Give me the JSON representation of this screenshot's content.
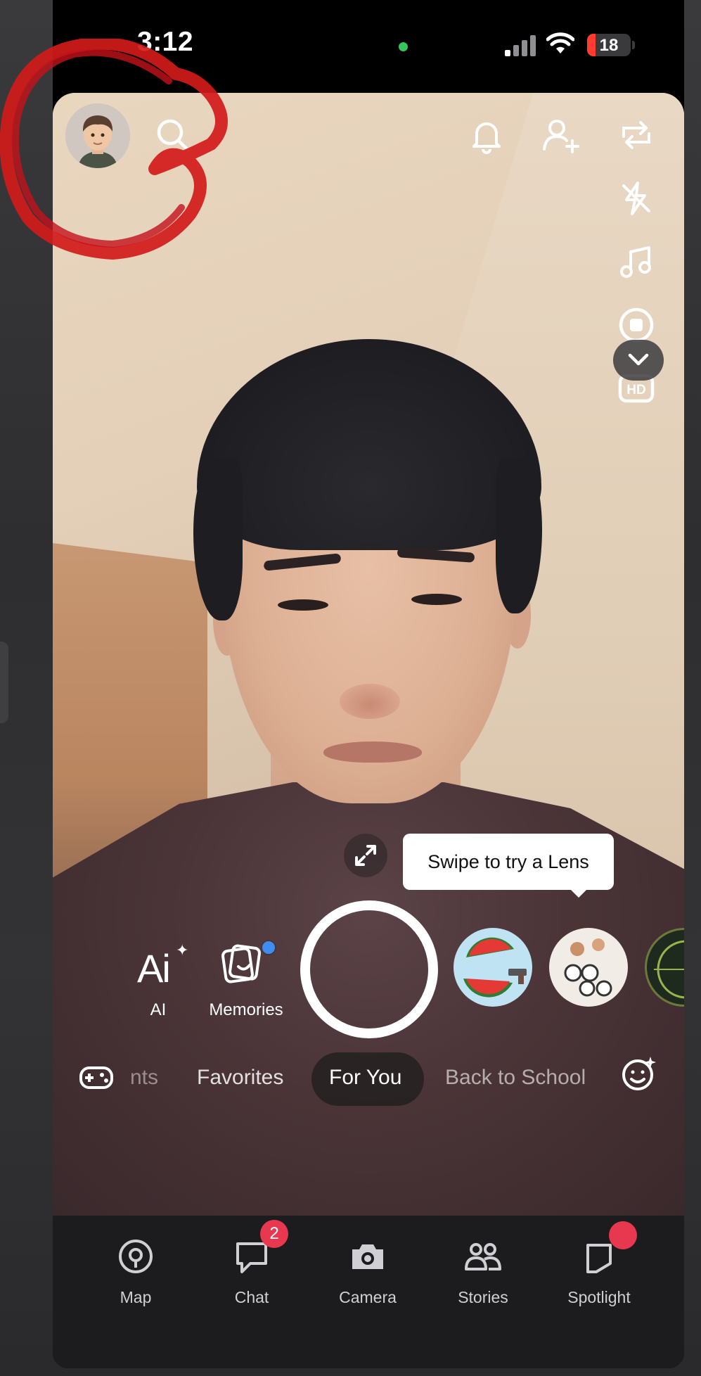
{
  "status_bar": {
    "time": "3:12",
    "battery": "18",
    "icons": [
      "signal-icon",
      "wifi-icon",
      "battery-icon"
    ],
    "camera_indicator_color": "#34c759"
  },
  "top_bar": {
    "left_icons": [
      "avatar",
      "search-icon"
    ],
    "right_icons": [
      "bell-icon",
      "add-friend-icon",
      "flip-camera-icon"
    ]
  },
  "right_rail": {
    "icons": [
      "flash-off-icon",
      "music-note-icon",
      "record-icon",
      "hd-icon",
      "chevron-down-icon"
    ],
    "hd_label": "HD"
  },
  "lens": {
    "tooltip": "Swipe to try a Lens",
    "ai_glyph": "Ai",
    "ai_label": "AI",
    "memories_label": "Memories",
    "thumbs": [
      "watermelon-lens",
      "glasses-faces-lens",
      "scope-lens"
    ]
  },
  "categories": {
    "items": [
      "nts",
      "Favorites",
      "For You",
      "Back to School"
    ],
    "active": "For You"
  },
  "bottom_nav": {
    "items": [
      {
        "label": "Map",
        "icon": "map-pin-icon"
      },
      {
        "label": "Chat",
        "icon": "chat-icon",
        "badge": "2"
      },
      {
        "label": "Camera",
        "icon": "camera-icon"
      },
      {
        "label": "Stories",
        "icon": "stories-icon"
      },
      {
        "label": "Spotlight",
        "icon": "spotlight-icon"
      }
    ]
  },
  "colors": {
    "accent_red": "#e8384f",
    "notification_blue": "#3d8ef0",
    "annotation_red": "#d11a1a"
  }
}
